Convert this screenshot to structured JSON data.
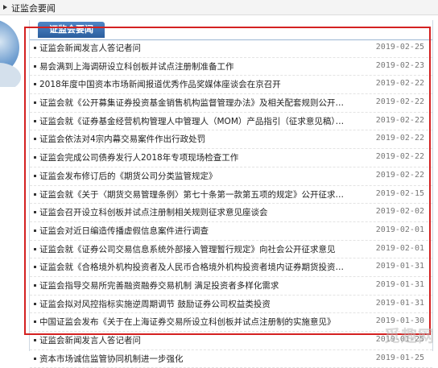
{
  "topbar": {
    "title": "证监会要闻"
  },
  "tab": {
    "label": "证监会要闻"
  },
  "news": [
    {
      "title": "证监会新闻发言人答记者问",
      "date": "2019-02-25"
    },
    {
      "title": "易会满到上海调研设立科创板并试点注册制准备工作",
      "date": "2019-02-23"
    },
    {
      "title": "2018年度中国资本市场新闻报道优秀作品奖媒体座谈会在京召开",
      "date": "2019-02-22"
    },
    {
      "title": "证监会就《公开募集证券投资基金销售机构监督管理办法》及相关配套规则公开征求意见",
      "date": "2019-02-22"
    },
    {
      "title": "证监会就《证券基金经营机构管理人中管理人（MOM）产品指引（征求意见稿）》公开征...",
      "date": "2019-02-22"
    },
    {
      "title": "证监会依法对4宗内幕交易案件作出行政处罚",
      "date": "2019-02-22"
    },
    {
      "title": "证监会完成公司债券发行人2018年专项现场检查工作",
      "date": "2019-02-22"
    },
    {
      "title": "证监会发布修订后的《期货公司分类监管规定》",
      "date": "2019-02-22"
    },
    {
      "title": "证监会就《关于〈期货交易管理条例〉第七十条第一款第五项的规定》公开征求意见",
      "date": "2019-02-15"
    },
    {
      "title": "证监会召开设立科创板并试点注册制相关规则征求意见座谈会",
      "date": "2019-02-02"
    },
    {
      "title": "证监会对近日编造传播虚假信息案件进行调查",
      "date": "2019-02-01"
    },
    {
      "title": "证监会就《证券公司交易信息系统外部接入管理暂行规定》向社会公开征求意见",
      "date": "2019-02-01"
    },
    {
      "title": "证监会就《合格境外机构投资者及人民币合格境外机构投资者境内证券期货投资管理办...",
      "date": "2019-01-31"
    },
    {
      "title": "证监会指导交易所完善融资融券交易机制 满足投资者多样化需求",
      "date": "2019-01-31"
    },
    {
      "title": "证监会拟对风控指标实施逆周期调节 鼓励证券公司权益类投资",
      "date": "2019-01-31"
    },
    {
      "title": "中国证监会发布《关于在上海证券交易所设立科创板并试点注册制的实施意见》",
      "date": "2019-01-30"
    },
    {
      "title": "证监会新闻发言人答记者问",
      "date": "2019-01-25"
    },
    {
      "title": "资本市场诚信监管协同机制进一步强化",
      "date": "2019-01-25"
    }
  ],
  "watermark": "觅趣网"
}
